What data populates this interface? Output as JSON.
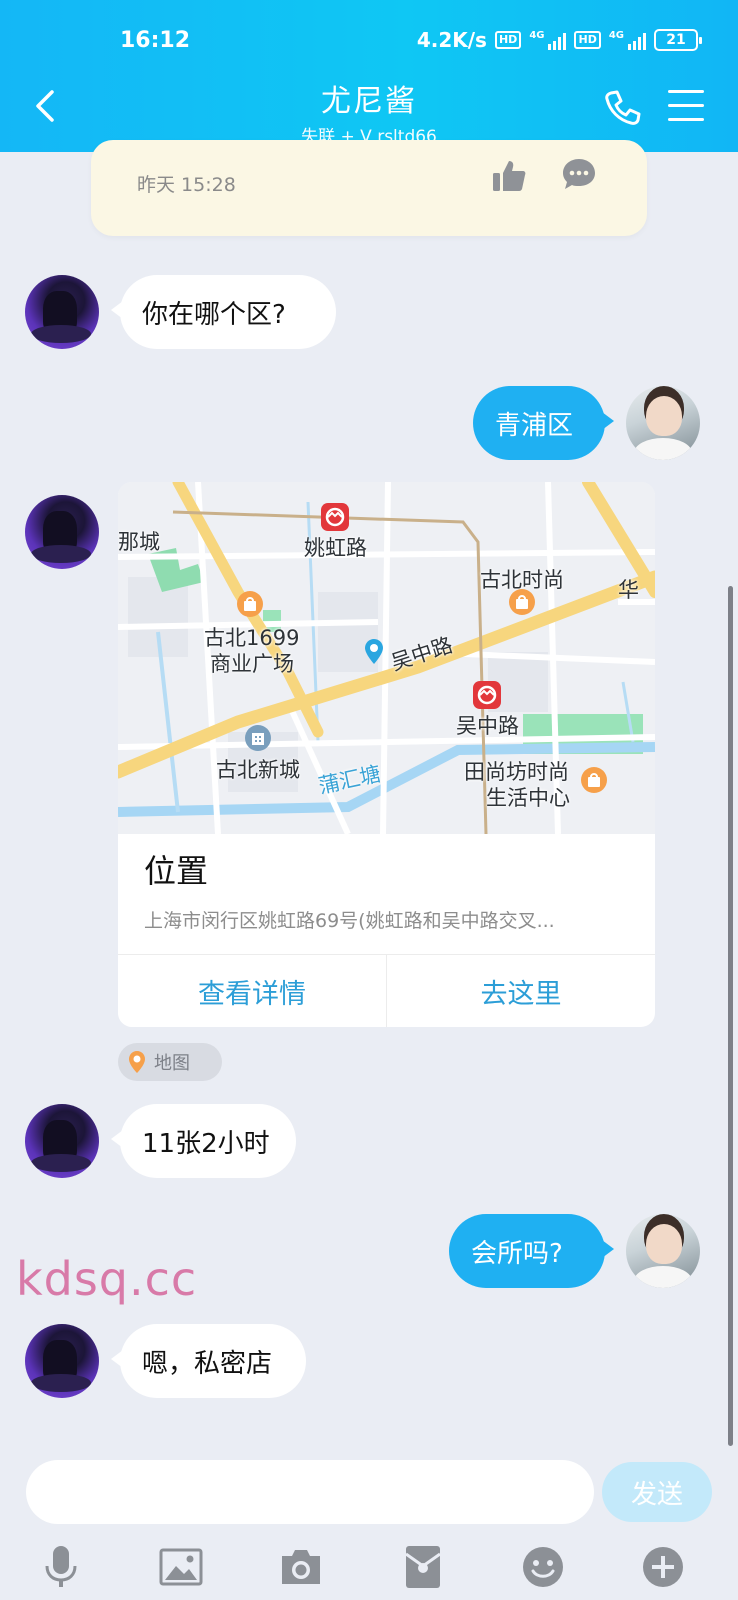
{
  "status_bar": {
    "time": "16:12",
    "speed": "4.2K/s",
    "hd_label": "HD",
    "network_label": "4G",
    "battery": "21"
  },
  "header": {
    "title": "尤尼酱",
    "subtitle": "失联 + V rsltd66"
  },
  "previous_post": {
    "time": "昨天 15:28"
  },
  "messages": [
    {
      "from": "her",
      "text": "你在哪个区?"
    },
    {
      "from": "me",
      "text": "青浦区"
    },
    {
      "from": "her",
      "type": "location"
    },
    {
      "from": "her",
      "text": "11张2小时"
    },
    {
      "from": "me",
      "text": "会所吗?"
    },
    {
      "from": "her",
      "text": "嗯，私密店"
    }
  ],
  "location_card": {
    "map_labels": {
      "l1": "那城",
      "metro_1": "姚虹路",
      "poi_1_line1": "古北1699",
      "poi_1_line2": "商业广场",
      "poi_2": "古北时尚",
      "poi_2b": "华",
      "road": "吴中路",
      "metro_2": "吴中路",
      "poi_3": "古北新城",
      "river": "蒲汇塘",
      "poi_4_line1": "田尚坊时尚",
      "poi_4_line2": "生活中心"
    },
    "title": "位置",
    "address": "上海市闵行区姚虹路69号(姚虹路和吴中路交叉...",
    "action_details": "查看详情",
    "action_go": "去这里",
    "tag": "地图"
  },
  "watermark": "kdsq.cc",
  "input": {
    "placeholder": "",
    "send_label": "发送"
  },
  "toolbar": [
    "mic-icon",
    "image-icon",
    "camera-icon",
    "red-packet-icon",
    "emoji-icon",
    "plus-icon"
  ],
  "colors": {
    "header_start": "#14b7f6",
    "outgoing_bubble": "#1fb0f2",
    "incoming_bubble": "#ffffff",
    "background": "#eaedf4",
    "send_button_disabled": "#c3e9fa"
  }
}
